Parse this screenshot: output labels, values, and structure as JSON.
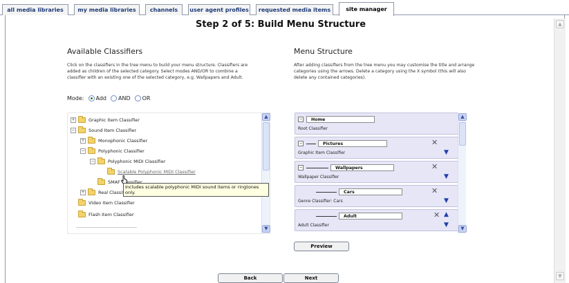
{
  "tabs": [
    {
      "label": "all media libraries",
      "active": false
    },
    {
      "label": "my media libraries",
      "active": false
    },
    {
      "label": "channels",
      "active": false
    },
    {
      "label": "user agent profiles",
      "active": false
    },
    {
      "label": "requested media items",
      "active": false
    },
    {
      "label": "site manager",
      "active": true
    }
  ],
  "page_title": "Step 2 of 5: Build Menu Structure",
  "available": {
    "title": "Available Classifiers",
    "description": "Click on the classifiers in the tree menu to build your menu structure. Classifiers are added as children of the selected category. Select modes AND/OR to combine a classifier with an existing one of the selected category, e.g. Wallpapers and Adult.",
    "mode_label": "Mode:",
    "modes": [
      {
        "label": "Add",
        "selected": true
      },
      {
        "label": "AND",
        "selected": false
      },
      {
        "label": "OR",
        "selected": false
      }
    ],
    "tree": [
      {
        "label": "Graphic Item Classifier",
        "expander": "+",
        "level": 0,
        "open": false
      },
      {
        "label": "Sound Item Classifier",
        "expander": "−",
        "level": 0,
        "open": true
      },
      {
        "label": "Monophonic Classifier",
        "expander": "+",
        "level": 1,
        "open": false
      },
      {
        "label": "Polyphonic Classifier",
        "expander": "−",
        "level": 1,
        "open": true
      },
      {
        "label": "Polyphonic MIDI Classifier",
        "expander": "−",
        "level": 2,
        "open": true
      },
      {
        "label": "Scalable Polyphonic MIDI Classifier",
        "expander": "",
        "level": 3,
        "open": false,
        "hovered": true
      },
      {
        "label": "SMAF Classifier",
        "expander": "",
        "level": 2,
        "open": false
      },
      {
        "label": "Real Classifier",
        "expander": "+",
        "level": 1,
        "open": false
      },
      {
        "label": "Video Item Classifier",
        "expander": "",
        "level": 0,
        "open": false
      },
      {
        "label": "Flash Item Classifier",
        "expander": "",
        "level": 0,
        "open": false
      }
    ],
    "tooltip": "Includes scalable polyphonic MIDI sound items or ringtones only."
  },
  "menu": {
    "title": "Menu Structure",
    "description": "After adding classifiers from the tree menu you may customise the title and arrange categories using the arrows. Delete a category using the X symbol (this will also delete any contained categories).",
    "items": [
      {
        "name": "Home",
        "classifier": "Root Classifier",
        "depth": 0,
        "removable": false,
        "up": false,
        "down": false
      },
      {
        "name": "Pictures",
        "classifier": "Graphic Item Classifier",
        "depth": 1,
        "removable": true,
        "up": false,
        "down": true
      },
      {
        "name": "Wallpapers",
        "classifier": "Wallpaper Classifier",
        "depth": 2,
        "removable": true,
        "up": false,
        "down": true
      },
      {
        "name": "Cars",
        "classifier": "Genre Classifier: Cars",
        "depth": 3,
        "removable": true,
        "up": false,
        "down": true
      },
      {
        "name": "Adult",
        "classifier": "Adult Classifier",
        "depth": 3,
        "removable": true,
        "up": true,
        "down": true
      }
    ],
    "preview_label": "Preview"
  },
  "nav": {
    "back_label": "Back",
    "next_label": "Next"
  },
  "icons": {
    "expand": "plus-box-icon",
    "collapse": "minus-box-icon",
    "folder": "folder-icon",
    "delete": "close-icon",
    "move_down": "arrow-down-icon",
    "move_up": "arrow-up-icon"
  }
}
